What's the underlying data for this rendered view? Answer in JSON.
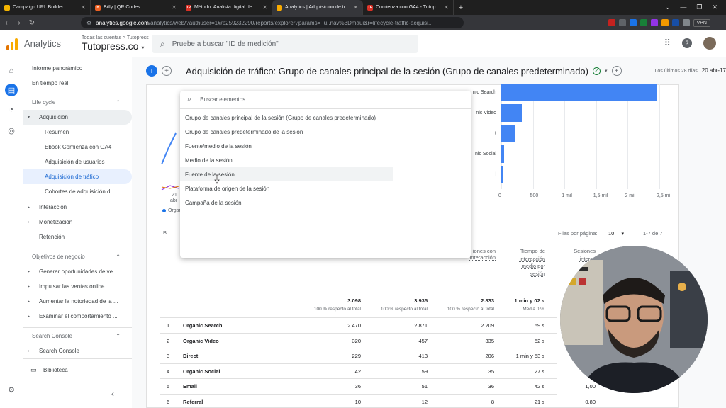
{
  "browser": {
    "tabs": [
      {
        "label": "Campaign URL Builder",
        "color": "#f4b400",
        "glyph": ""
      },
      {
        "label": "Bitly | QR Codes",
        "color": "#ee6123",
        "glyph": "b"
      },
      {
        "label": "Método: Analista digital de cero a m",
        "color": "#d93025",
        "glyph": "TP"
      },
      {
        "label": "Analytics | Adquisición de tráfico",
        "color": "#f9ab00",
        "glyph": ""
      },
      {
        "label": "Comienza con GA4 - Tutopress",
        "color": "#d93025",
        "glyph": "TP"
      }
    ],
    "url_domain": "analytics.google.com",
    "url_rest": "/analytics/web/?authuser=1#/p259232290/reports/explorer?params=_u..nav%3Dmaui&r=lifecycle-traffic-acquisi...",
    "vpn_label": "VPN"
  },
  "header": {
    "app_title": "Analytics",
    "crumb": "Todas las cuentas > Tutopress",
    "property": "Tutopress.co",
    "search_placeholder": "Pruebe a buscar \"ID de medición\""
  },
  "sidebar": {
    "items": [
      {
        "label": "Informe panorámico",
        "indent": 12,
        "type": "item"
      },
      {
        "label": "En tiempo real",
        "indent": 12,
        "type": "item"
      },
      {
        "label": "Life cycle",
        "indent": 12,
        "type": "section"
      },
      {
        "label": "Adquisición",
        "indent": 22,
        "type": "group",
        "arrow": "▾"
      },
      {
        "label": "Resumen",
        "indent": 30,
        "type": "item"
      },
      {
        "label": "Ebook Comienza con GA4",
        "indent": 30,
        "type": "item"
      },
      {
        "label": "Adquisición de usuarios",
        "indent": 30,
        "type": "item"
      },
      {
        "label": "Adquisición de tráfico",
        "indent": 30,
        "type": "selected"
      },
      {
        "label": "Cohortes de adquisición d...",
        "indent": 30,
        "type": "item"
      },
      {
        "label": "Interacción",
        "indent": 22,
        "type": "group",
        "arrow": "▸"
      },
      {
        "label": "Monetización",
        "indent": 22,
        "type": "group",
        "arrow": "▸"
      },
      {
        "label": "Retención",
        "indent": 22,
        "type": "item"
      },
      {
        "label": "Objetivos de negocio",
        "indent": 12,
        "type": "section"
      },
      {
        "label": "Generar oportunidades de ve...",
        "indent": 22,
        "type": "group",
        "arrow": "▸"
      },
      {
        "label": "Impulsar las ventas online",
        "indent": 22,
        "type": "group",
        "arrow": "▸"
      },
      {
        "label": "Aumentar la notoriedad de la ...",
        "indent": 22,
        "type": "group",
        "arrow": "▸"
      },
      {
        "label": "Examinar el comportamiento ...",
        "indent": 22,
        "type": "group",
        "arrow": "▸"
      },
      {
        "label": "Search Console",
        "indent": 12,
        "type": "section"
      },
      {
        "label": "Search Console",
        "indent": 22,
        "type": "group",
        "arrow": "▸"
      },
      {
        "label": "Biblioteca",
        "indent": 28,
        "type": "library"
      }
    ]
  },
  "report": {
    "badge": "T",
    "title": "Adquisición de tráfico: Grupo de canales principal de la sesión (Grupo de canales predeterminado)",
    "date_caption": "Los últimos 28 días",
    "date_range": "20 abr-17"
  },
  "dropdown": {
    "search_placeholder": "Buscar elementos",
    "items": [
      "Grupo de canales principal de la sesión (Grupo de canales predeterminado)",
      "Grupo de canales predeterminado de la sesión",
      "Fuente/medio de la sesión",
      "Medio de la sesión",
      "Fuente de la sesión",
      "Plataforma de origen de la sesión",
      "Campaña de la sesión"
    ],
    "hovered_index": 4
  },
  "chart_data": {
    "type": "bar",
    "orientation": "horizontal",
    "categories": [
      "Organic Search",
      "Organic Video",
      "Direct",
      "Organic Social",
      "Email"
    ],
    "visible_category_labels": [
      "nic Search",
      "nic Video",
      "t",
      "nic Social",
      "l"
    ],
    "values": [
      2470,
      320,
      229,
      42,
      36
    ],
    "xlim": [
      0,
      2500
    ],
    "xticks": [
      "0",
      "500",
      "1 mil",
      "1,5 mil",
      "2 mil",
      "2,5 mi"
    ],
    "color": "#4285f4",
    "line_chart_partial": {
      "x_tick": "21",
      "x_sub": "abr",
      "legend": "Organ"
    }
  },
  "table": {
    "search_placeholder": "B",
    "rows_per_page_label": "Filas por página:",
    "rows_per_page": "10",
    "pagination": "1-7 de 7",
    "headers": [
      "iones con interacción",
      "Tiempo de interacción medio por sesión",
      "Sesiones interac"
    ],
    "totals": [
      {
        "value": "3.098",
        "sub": "100 % respecto al total"
      },
      {
        "value": "3.935",
        "sub": "100 % respecto al total"
      },
      {
        "value": "2.833",
        "sub": "100 % respecto al total"
      },
      {
        "value": "1 min y 02 s",
        "sub": "Media 0 %"
      }
    ],
    "rows": [
      {
        "n": "1",
        "name": "Organic Search",
        "c1": "2.470",
        "c2": "2.871",
        "c3": "2.209",
        "c4": "59 s",
        "c5": ""
      },
      {
        "n": "2",
        "name": "Organic Video",
        "c1": "320",
        "c2": "457",
        "c3": "335",
        "c4": "52 s",
        "c5": ""
      },
      {
        "n": "3",
        "name": "Direct",
        "c1": "229",
        "c2": "413",
        "c3": "206",
        "c4": "1 min y 53 s",
        "c5": ""
      },
      {
        "n": "4",
        "name": "Organic Social",
        "c1": "42",
        "c2": "59",
        "c3": "35",
        "c4": "27 s",
        "c5": ""
      },
      {
        "n": "5",
        "name": "Email",
        "c1": "36",
        "c2": "51",
        "c3": "36",
        "c4": "42 s",
        "c5": "1,00"
      },
      {
        "n": "6",
        "name": "Referral",
        "c1": "10",
        "c2": "12",
        "c3": "8",
        "c4": "21 s",
        "c5": "0,80"
      }
    ]
  }
}
